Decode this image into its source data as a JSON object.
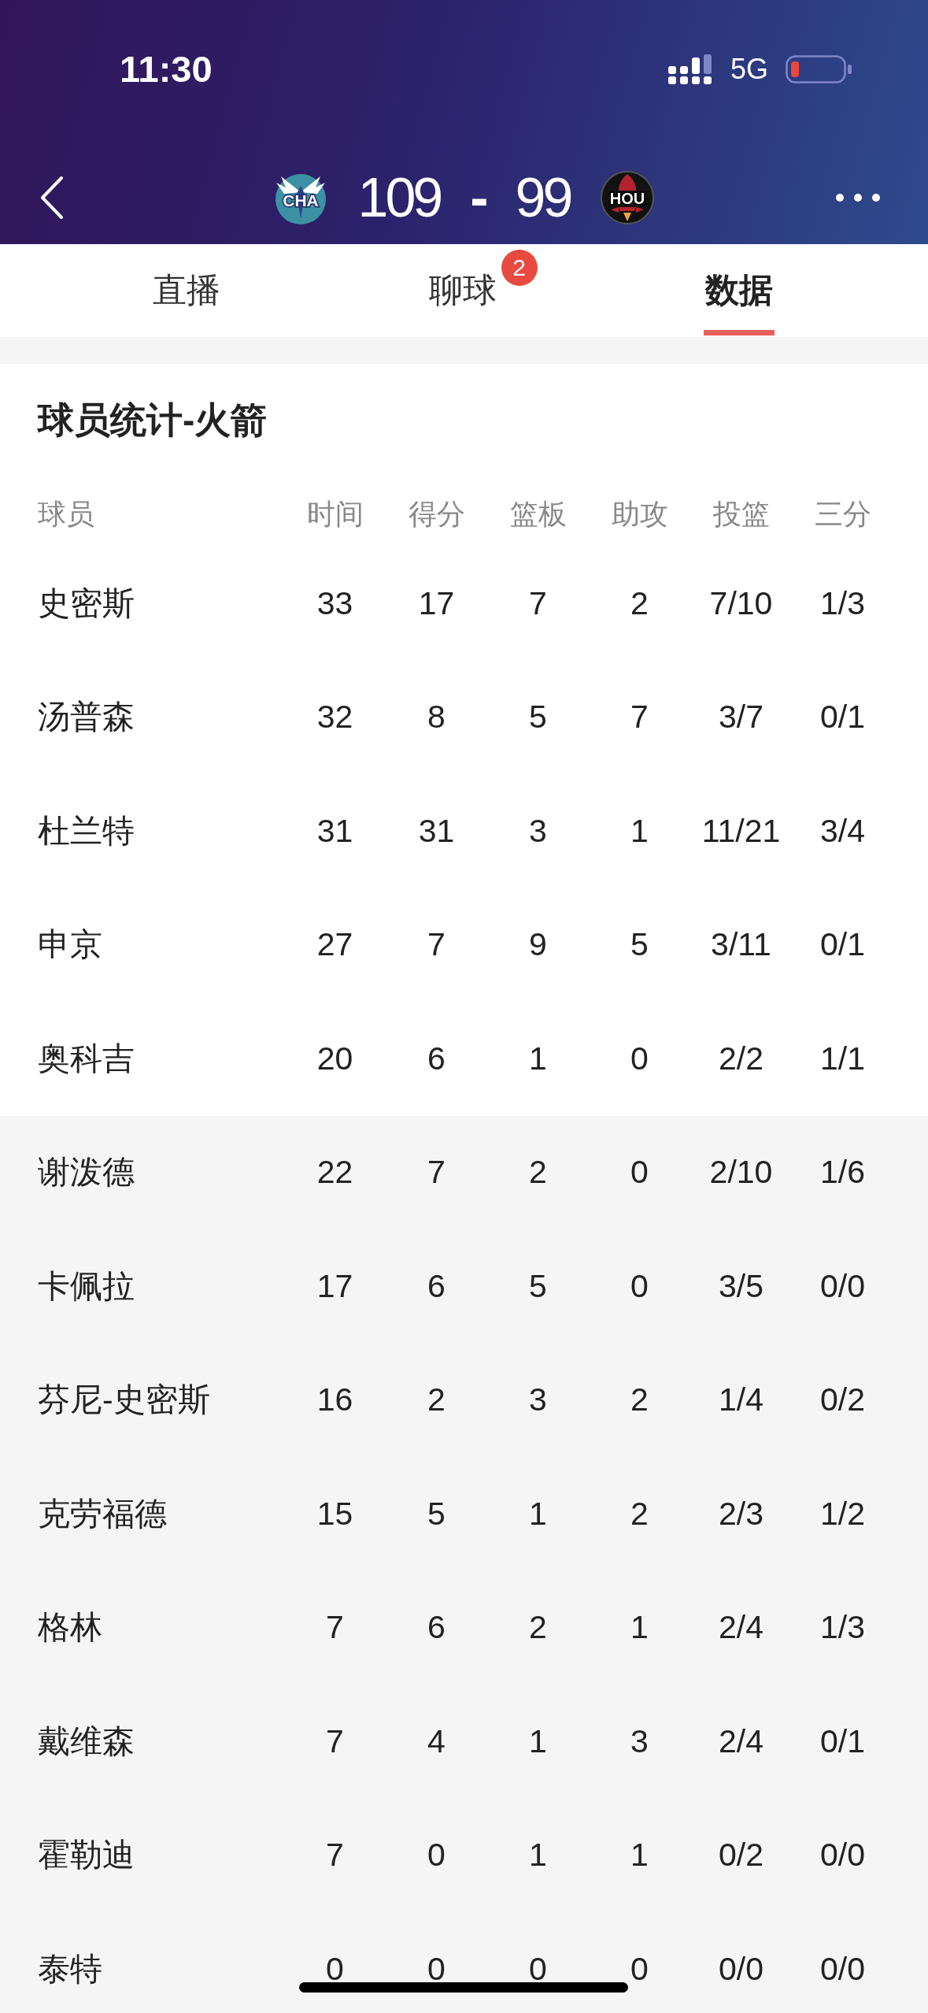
{
  "status_bar": {
    "time": "11:30",
    "network": "5G"
  },
  "scoreboard": {
    "home": {
      "abbr": "CHA",
      "score": "109"
    },
    "separator": "-",
    "away": {
      "abbr": "HOU",
      "score": "99"
    }
  },
  "tabs": [
    {
      "label": "直播",
      "selected": false
    },
    {
      "label": "聊球",
      "selected": false,
      "badge": "2"
    },
    {
      "label": "数据",
      "selected": true
    }
  ],
  "stats_card": {
    "title": "球员统计-火箭",
    "columns": [
      "球员",
      "时间",
      "得分",
      "篮板",
      "助攻",
      "投篮",
      "三分"
    ],
    "rows": [
      {
        "kind": "starter",
        "cells": [
          "史密斯",
          "33",
          "17",
          "7",
          "2",
          "7/10",
          "1/3"
        ]
      },
      {
        "kind": "starter",
        "cells": [
          "汤普森",
          "32",
          "8",
          "5",
          "7",
          "3/7",
          "0/1"
        ]
      },
      {
        "kind": "starter",
        "cells": [
          "杜兰特",
          "31",
          "31",
          "3",
          "1",
          "11/21",
          "3/4"
        ]
      },
      {
        "kind": "starter",
        "cells": [
          "申京",
          "27",
          "7",
          "9",
          "5",
          "3/11",
          "0/1"
        ]
      },
      {
        "kind": "starter",
        "cells": [
          "奥科吉",
          "20",
          "6",
          "1",
          "0",
          "2/2",
          "1/1"
        ]
      },
      {
        "kind": "bench",
        "cells": [
          "谢泼德",
          "22",
          "7",
          "2",
          "0",
          "2/10",
          "1/6"
        ]
      },
      {
        "kind": "bench",
        "cells": [
          "卡佩拉",
          "17",
          "6",
          "5",
          "0",
          "3/5",
          "0/0"
        ]
      },
      {
        "kind": "bench",
        "cells": [
          "芬尼-史密斯",
          "16",
          "2",
          "3",
          "2",
          "1/4",
          "0/2"
        ]
      },
      {
        "kind": "bench",
        "cells": [
          "克劳福德",
          "15",
          "5",
          "1",
          "2",
          "2/3",
          "1/2"
        ]
      },
      {
        "kind": "bench",
        "cells": [
          "格林",
          "7",
          "6",
          "2",
          "1",
          "2/4",
          "1/3"
        ]
      },
      {
        "kind": "bench",
        "cells": [
          "戴维森",
          "7",
          "4",
          "1",
          "3",
          "2/4",
          "0/1"
        ]
      },
      {
        "kind": "bench",
        "cells": [
          "霍勒迪",
          "7",
          "0",
          "1",
          "1",
          "0/2",
          "0/0"
        ]
      },
      {
        "kind": "bench",
        "cells": [
          "泰特",
          "0",
          "0",
          "0",
          "0",
          "0/0",
          "0/0"
        ]
      }
    ]
  }
}
